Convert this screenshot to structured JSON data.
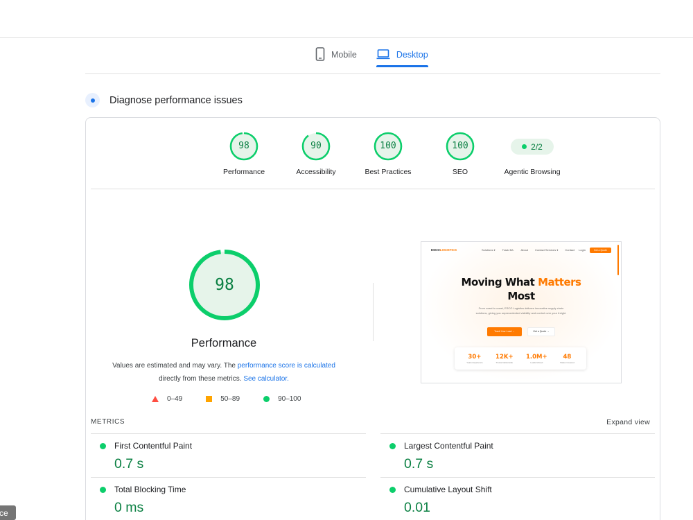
{
  "device_tabs": [
    {
      "label": "Mobile",
      "icon": "mobile-phone-icon",
      "active": false
    },
    {
      "label": "Desktop",
      "icon": "laptop-icon",
      "active": true
    }
  ],
  "section": {
    "title": "Diagnose performance issues"
  },
  "categories": [
    {
      "score": "98",
      "label": "Performance"
    },
    {
      "score": "90",
      "label": "Accessibility"
    },
    {
      "score": "100",
      "label": "Best Practices"
    },
    {
      "score": "100",
      "label": "SEO"
    }
  ],
  "agentic": {
    "value": "2/2",
    "label": "Agentic Browsing"
  },
  "main_score": {
    "score": "98",
    "label": "Performance",
    "note_prefix": "Values are estimated and may vary. The ",
    "note_link1": "performance score is calculated",
    "note_middle": " directly from these metrics. ",
    "note_link2": "See calculator."
  },
  "legend": [
    {
      "shape": "triangle",
      "range": "0–49",
      "color": "#ff4e42"
    },
    {
      "shape": "square",
      "range": "50–89",
      "color": "#ffa400"
    },
    {
      "shape": "circle",
      "range": "90–100",
      "color": "#0cce6b"
    }
  ],
  "thumbnail": {
    "logo_a": "ESCO",
    "logo_b": "LOGISTICS",
    "nav": [
      "Solutions ▾",
      "Track B/L",
      "About",
      "Contact Services ▾",
      "Contact"
    ],
    "login": "Login",
    "cta_nav": "Get a Quote",
    "headline_a": "Moving What ",
    "headline_b": "Matters",
    "headline_c": "Most",
    "subtitle": "From coast to coast, ESCO Logistics delivers innovative supply chain solutions, giving you unprecedented visibility and control over your freight.",
    "cta_primary": "Track Your Load →",
    "cta_secondary": "Get a Quote →",
    "stats": [
      {
        "value": "30+",
        "label": "Years Experience"
      },
      {
        "value": "12K+",
        "label": "Trucks Nationwide"
      },
      {
        "value": "1.0M+",
        "label": "Loads Moved"
      },
      {
        "value": "48",
        "label": "States Covered"
      }
    ]
  },
  "metrics": {
    "heading": "METRICS",
    "expand": "Expand view",
    "items": [
      {
        "name": "First Contentful Paint",
        "value": "0.7 s"
      },
      {
        "name": "Largest Contentful Paint",
        "value": "0.7 s"
      },
      {
        "name": "Total Blocking Time",
        "value": "0 ms"
      },
      {
        "name": "Cumulative Layout Shift",
        "value": "0.01"
      }
    ]
  },
  "bottom_chip": "ce",
  "colors": {
    "pass": "#0cce6b",
    "pass_text": "#0b8043",
    "accent": "#1a73e8"
  }
}
